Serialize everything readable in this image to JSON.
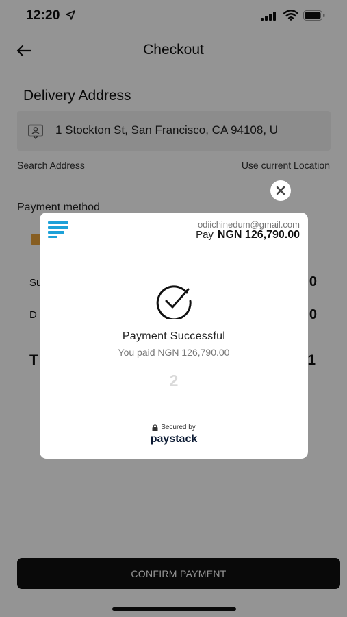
{
  "status_bar": {
    "time": "12:20"
  },
  "header": {
    "title": "Checkout"
  },
  "delivery": {
    "section_title": "Delivery Address",
    "address": "1 Stockton St, San Francisco, CA  94108, U",
    "search_link": "Search Address",
    "location_link": "Use current Location"
  },
  "payment": {
    "label": "Payment method"
  },
  "summary": {
    "subtotal_label": "Su",
    "subtotal_value": "0",
    "delivery_label": "D",
    "delivery_value": "0",
    "total_label": "T",
    "total_value": "1"
  },
  "footer": {
    "confirm_label": "CONFIRM PAYMENT"
  },
  "modal": {
    "email": "odiichinedum@gmail.com",
    "pay_label": "Pay",
    "pay_amount": "NGN 126,790.00",
    "success_title": "Payment Successful",
    "success_sub": "You paid NGN 126,790.00",
    "countdown": "2",
    "secured_by": "Secured by",
    "brand": "paystack"
  },
  "colors": {
    "accent_blue": "#1da1d8",
    "button_bg": "#111111",
    "overlay": "rgba(0,0,0,0.42)"
  },
  "icons": [
    "location-arrow-icon",
    "signal-icon",
    "wifi-icon",
    "battery-icon",
    "back-arrow-icon",
    "address-book-icon",
    "close-icon",
    "check-circle-icon",
    "lock-icon",
    "merchant-logo-icon"
  ]
}
